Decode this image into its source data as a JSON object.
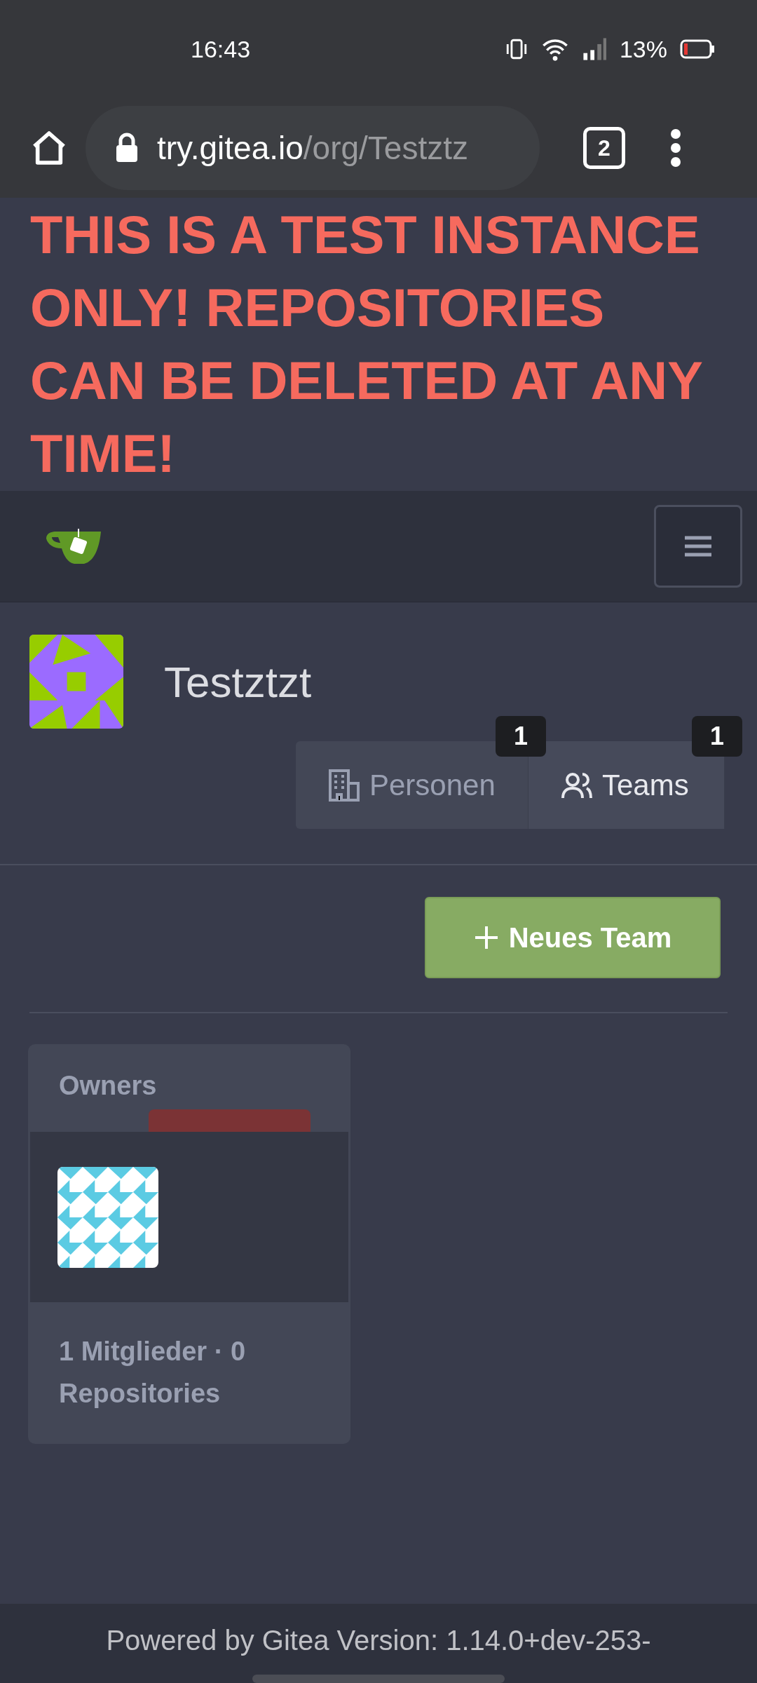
{
  "status_bar": {
    "time": "16:43",
    "battery": "13%"
  },
  "browser": {
    "url_host": "try.gitea.io",
    "url_path": "/org/Testztz",
    "tab_count": "2"
  },
  "banner": {
    "text": "THIS IS A TEST INSTANCE ONLY! REPOSITORIES CAN BE DELETED AT ANY TIME!"
  },
  "org": {
    "name": "Testztzt"
  },
  "tabs": [
    {
      "label": "Personen",
      "count": "1",
      "selected": false,
      "kind": "building"
    },
    {
      "label": "Teams",
      "count": "1",
      "selected": true,
      "kind": "people"
    }
  ],
  "new_team_button": {
    "label": "Neues Team"
  },
  "teams": [
    {
      "name": "Owners",
      "summary": "1 Mitglieder · 0 Repositories"
    }
  ],
  "footer": {
    "text": "Powered by Gitea Version: 1.14.0+dev-253-"
  }
}
